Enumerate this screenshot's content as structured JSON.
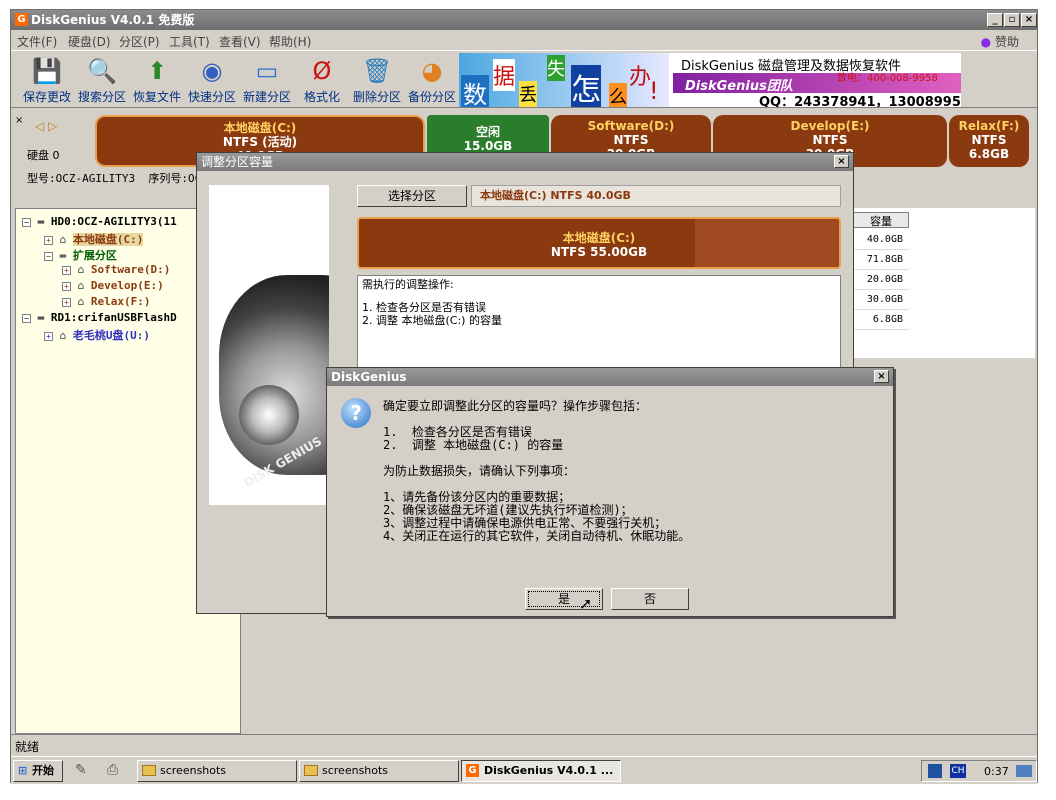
{
  "window": {
    "title": "DiskGenius V4.0.1 免费版"
  },
  "menu": [
    "文件(F)",
    "硬盘(D)",
    "分区(P)",
    "工具(T)",
    "查看(V)",
    "帮助(H)"
  ],
  "donate": "赞助",
  "toolbar": [
    "保存更改",
    "搜索分区",
    "恢复文件",
    "快速分区",
    "新建分区",
    "格式化",
    "删除分区",
    "备份分区"
  ],
  "banner": {
    "title": "DiskGenius 磁盘管理及数据恢复软件",
    "chars": [
      "数",
      "据",
      "丢",
      "失",
      "怎",
      "么",
      "办",
      "!"
    ],
    "brand": "DiskGenius团队",
    "phone": "致电：400-008-9958",
    "qq": "QQ：243378941，13008995 8"
  },
  "disk": {
    "label": "硬盘 0",
    "model": "型号:OCZ-AGILITY3",
    "serial": "序列号:OC"
  },
  "partitions": [
    {
      "name": "本地磁盘(C:)",
      "fs": "NTFS (活动)",
      "size": "40.0GB",
      "color": "#8b3a10"
    },
    {
      "name": "空闲",
      "fs": "",
      "size": "15.0GB",
      "color": "#2a7d2a"
    },
    {
      "name": "Software(D:)",
      "fs": "NTFS",
      "size": "20.0GB",
      "color": "#8b3a10"
    },
    {
      "name": "Develop(E:)",
      "fs": "NTFS",
      "size": "30.0GB",
      "color": "#8b3a10"
    },
    {
      "name": "Relax(F:)",
      "fs": "NTFS",
      "size": "6.8GB",
      "color": "#8b3a10"
    }
  ],
  "tree": [
    {
      "text": "HD0:OCZ-AGILITY3(11",
      "color": "#000"
    },
    {
      "text": "本地磁盘(C:)",
      "color": "#8b3a10"
    },
    {
      "text": "扩展分区",
      "color": "#006000"
    },
    {
      "text": "Software(D:)",
      "color": "#8b3a10"
    },
    {
      "text": "Develop(E:)",
      "color": "#8b3a10"
    },
    {
      "text": "Relax(F:)",
      "color": "#8b3a10"
    },
    {
      "text": "RD1:crifanUSBFlashD",
      "color": "#000"
    },
    {
      "text": "老毛桃U盘(U:)",
      "color": "#3030c0"
    }
  ],
  "grid": {
    "header": "容量",
    "values": [
      "40.0GB",
      "71.8GB",
      "20.0GB",
      "30.0GB",
      "6.8GB"
    ]
  },
  "status": "就绪",
  "taskbar": {
    "start": "开始",
    "tasks": [
      "screenshots",
      "screenshots",
      "DiskGenius V4.0.1 ..."
    ],
    "lang": "CH",
    "clock": "0:37"
  },
  "resize_dialog": {
    "title": "调整分区容量",
    "select_button": "选择分区",
    "selected": "本地磁盘(C:) NTFS 40.0GB",
    "bar_name": "本地磁盘(C:)",
    "bar_info": "NTFS 55.00GB",
    "ops_title": "需执行的调整操作:",
    "ops": [
      "1. 检查各分区是否有错误",
      "2. 调整 本地磁盘(C:) 的容量"
    ],
    "image_text": "DISK GENIUS"
  },
  "confirm_dialog": {
    "title": "DiskGenius",
    "question": "确定要立即调整此分区的容量吗？操作步骤包括：",
    "steps": [
      "1.  检查各分区是否有错误",
      "2.  调整 本地磁盘(C:) 的容量"
    ],
    "warn": "为防止数据损失，请确认下列事项：",
    "items": [
      "1、请先备份该分区内的重要数据；",
      "2、确保该磁盘无坏道(建议先执行坏道检测)；",
      "3、调整过程中请确保电源供电正常、不要强行关机；",
      "4、关闭正在运行的其它软件，关闭自动待机、休眠功能。"
    ],
    "yes": "是",
    "no": "否"
  }
}
